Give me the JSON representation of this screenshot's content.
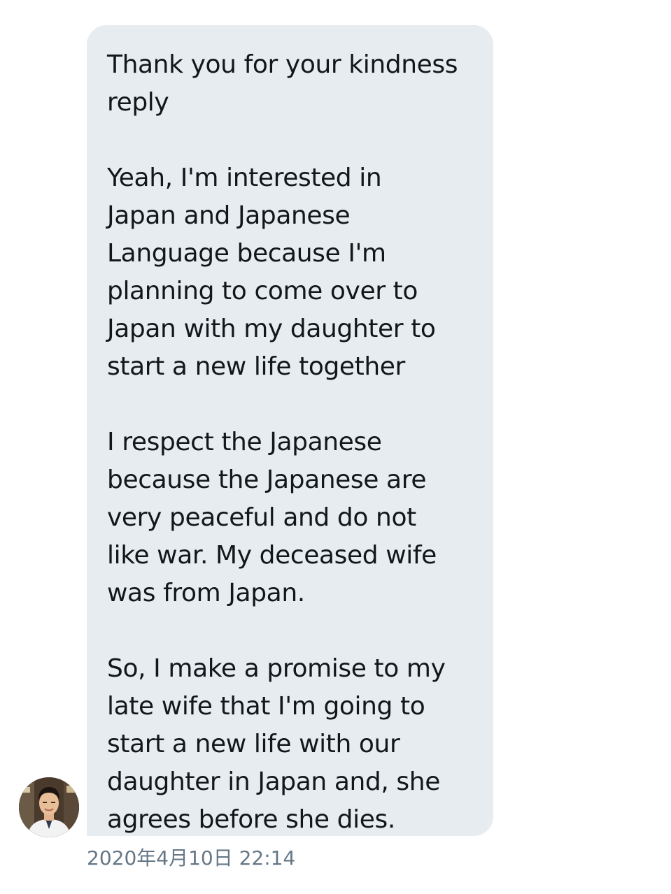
{
  "message": {
    "paragraphs": [
      "Thank you for your kindness\nreply",
      "Yeah, I'm interested in\nJapan and Japanese\nLanguage because I'm\nplanning to come over to\nJapan with my daughter to\nstart a new life together",
      "I respect the Japanese\nbecause the Japanese are\nvery peaceful and do not\nlike war. My deceased wife\nwas from Japan.",
      "So, I make a promise to my\nlate wife that I'm going to\nstart a new life with our\ndaughter in Japan and, she\nagrees before she dies."
    ],
    "timestamp": "2020年4月10日 22:14"
  },
  "sender": {
    "avatar_icon": "profile-photo"
  },
  "colors": {
    "bubble_background": "#e7ecf0",
    "message_text": "#14171a",
    "timestamp_text": "#657786"
  }
}
